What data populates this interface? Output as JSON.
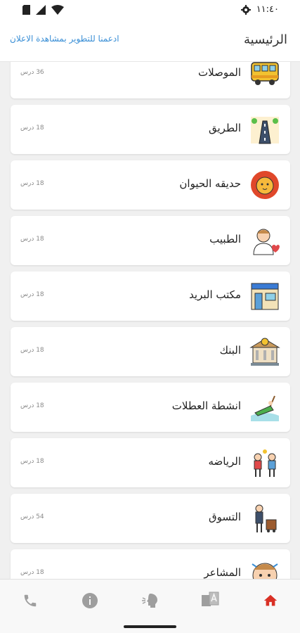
{
  "status_bar": {
    "time": "١١:٤٠",
    "icons": [
      "sim-icon",
      "signal-icon",
      "wifi-icon",
      "gear-icon",
      "battery-icon"
    ]
  },
  "header": {
    "title": "الرئيسية",
    "support_link": "ادعمنا للتطوير بمشاهدة الاعلان"
  },
  "categories": [
    {
      "name": "الموصلات",
      "count": "36 درس",
      "icon": "bus-icon"
    },
    {
      "name": "الطريق",
      "count": "18 درس",
      "icon": "road-icon"
    },
    {
      "name": "حديقه الحيوان",
      "count": "18 درس",
      "icon": "lion-icon"
    },
    {
      "name": "الطبيب",
      "count": "18 درس",
      "icon": "doctor-icon"
    },
    {
      "name": "مكتب البريد",
      "count": "18 درس",
      "icon": "post-office-icon"
    },
    {
      "name": "البنك",
      "count": "18 درس",
      "icon": "bank-icon"
    },
    {
      "name": "انشطة العطلات",
      "count": "18 درس",
      "icon": "beach-icon"
    },
    {
      "name": "الرياضه",
      "count": "18 درس",
      "icon": "sports-icon"
    },
    {
      "name": "التسوق",
      "count": "54 درس",
      "icon": "shopping-icon"
    },
    {
      "name": "المشاعر",
      "count": "18 درس",
      "icon": "feelings-icon"
    }
  ],
  "bottom_nav": {
    "items": [
      "phone-icon",
      "info-icon",
      "speak-icon",
      "translate-icon",
      "home-icon"
    ],
    "active": "home-icon",
    "active_color": "#d93025",
    "inactive_color": "#9e9e9e"
  }
}
